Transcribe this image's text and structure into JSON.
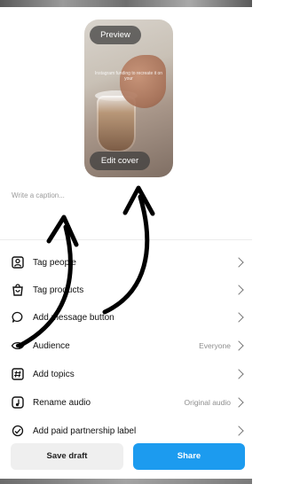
{
  "preview": {
    "label": "Preview",
    "edit_cover": "Edit cover",
    "overlay_text": "Instagram funding to recreate it on your"
  },
  "caption": {
    "placeholder": "Write a caption..."
  },
  "menu": [
    {
      "label": "Tag people",
      "value": "",
      "icon": "tag-people-icon"
    },
    {
      "label": "Tag products",
      "value": "",
      "icon": "shopping-bag-icon"
    },
    {
      "label": "Add message button",
      "value": "",
      "icon": "message-bubble-icon"
    },
    {
      "label": "Audience",
      "value": "Everyone",
      "icon": "eye-icon"
    },
    {
      "label": "Add topics",
      "value": "",
      "icon": "hashtag-icon"
    },
    {
      "label": "Rename audio",
      "value": "Original audio",
      "icon": "audio-icon"
    },
    {
      "label": "Add paid partnership label",
      "value": "",
      "icon": "partnership-icon"
    }
  ],
  "buttons": {
    "save_draft": "Save draft",
    "share": "Share"
  },
  "colors": {
    "accent": "#1c9bef",
    "secondary_btn": "#efefef"
  }
}
